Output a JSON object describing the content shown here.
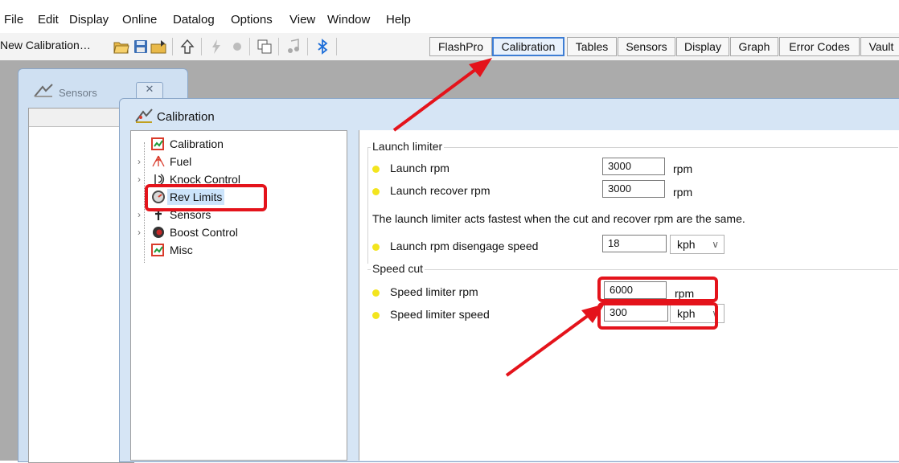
{
  "menu": [
    "File",
    "Edit",
    "Display",
    "Online",
    "Datalog",
    "Options",
    "View",
    "Window",
    "Help"
  ],
  "toolbar": {
    "new_calibration": "New Calibration…",
    "tabs": [
      "FlashPro",
      "Calibration",
      "Tables",
      "Sensors",
      "Display",
      "Graph",
      "Error Codes",
      "Vault"
    ],
    "active_tab": "Calibration"
  },
  "sensors_window": {
    "title": "Sensors",
    "close_glyph": "✕"
  },
  "calibration_window": {
    "title": "Calibration",
    "tree": [
      {
        "label": "Calibration",
        "icon": "calibration-icon",
        "expandable": false
      },
      {
        "label": "Fuel",
        "icon": "fuel-icon",
        "expandable": true
      },
      {
        "label": "Knock Control",
        "icon": "knock-icon",
        "expandable": true
      },
      {
        "label": "Rev Limits",
        "icon": "rev-limits-icon",
        "expandable": false,
        "selected": true
      },
      {
        "label": "Sensors",
        "icon": "sensors-icon",
        "expandable": true
      },
      {
        "label": "Boost Control",
        "icon": "boost-icon",
        "expandable": true
      },
      {
        "label": "Misc",
        "icon": "misc-icon",
        "expandable": false
      }
    ]
  },
  "panel": {
    "launch_group": "Launch limiter",
    "launch_rpm": {
      "label": "Launch rpm",
      "value": "3000",
      "unit": "rpm"
    },
    "launch_recover": {
      "label": "Launch recover rpm",
      "value": "3000",
      "unit": "rpm"
    },
    "note": "The launch limiter acts fastest when the cut and recover rpm are the same.",
    "disengage": {
      "label": "Launch rpm disengage speed",
      "value": "18",
      "unit": "kph",
      "chevron": "∨"
    },
    "speed_group": "Speed cut",
    "speed_rpm": {
      "label": "Speed limiter rpm",
      "value": "6000",
      "unit": "rpm"
    },
    "speed_speed": {
      "label": "Speed limiter speed",
      "value": "300",
      "unit": "kph",
      "chevron": "∨"
    }
  },
  "colors": {
    "highlight": "#e4131b",
    "active_tab_border": "#3d7dd4",
    "row_dot": "#f3e51e"
  }
}
